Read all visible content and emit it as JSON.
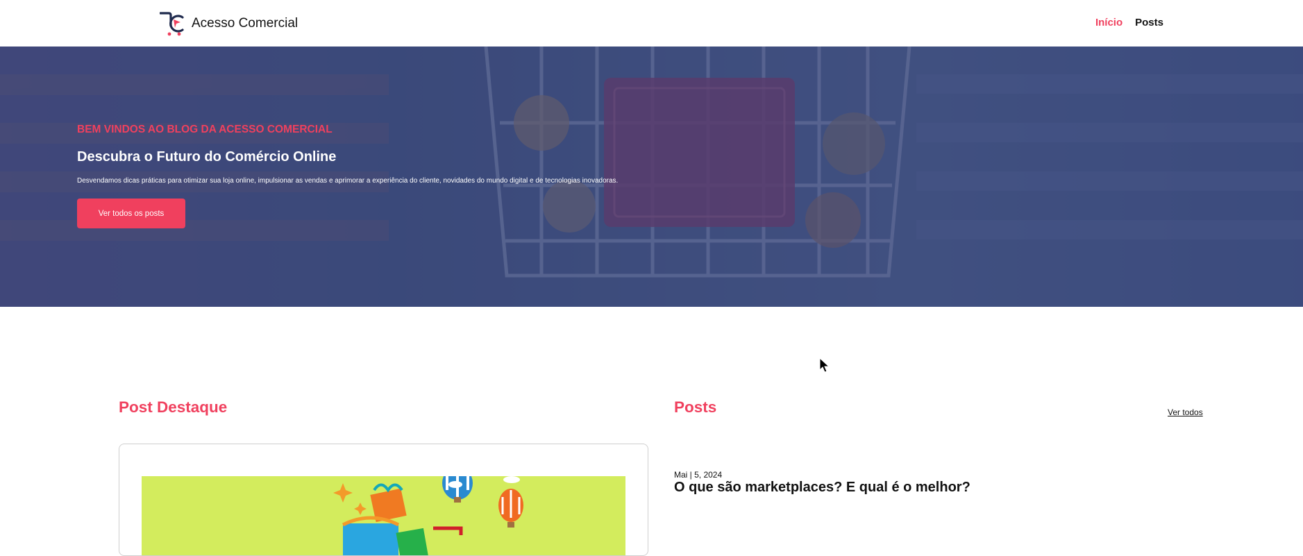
{
  "header": {
    "brand_name": "Acesso Comercial",
    "logo_icon": "shopping-cart-logo-icon",
    "nav": [
      {
        "label": "Início",
        "active": true
      },
      {
        "label": "Posts",
        "active": false
      }
    ]
  },
  "hero": {
    "kicker": "BEM VINDOS AO BLOG DA ACESSO COMERCIAL",
    "title": "Descubra o Futuro do Comércio Online",
    "description": "Desvendamos dicas práticas para otimizar sua loja online, impulsionar as vendas e aprimorar a experiência do cliente, novidades do mundo digital e de tecnologias inovadoras.",
    "button_label": "Ver todos os posts",
    "background_image": "supermarket-shopping-cart"
  },
  "featured": {
    "section_title": "Post Destaque",
    "image": "gifts-and-balloons-illustration"
  },
  "posts": {
    "section_title": "Posts",
    "see_all_label": "Ver todos",
    "items": [
      {
        "date": "Mai | 5, 2024",
        "title": "O que são marketplaces? E qual é o melhor?"
      }
    ]
  },
  "colors": {
    "accent": "#f0405e",
    "hero_overlay": "#30407a",
    "featured_bg": "#d3ec5d"
  }
}
